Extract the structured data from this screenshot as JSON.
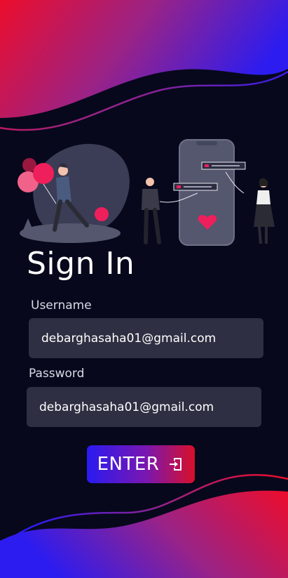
{
  "colors": {
    "background": "#07081c",
    "field_bg": "#2e2f42",
    "accent_red": "#e8102a",
    "accent_blue": "#2a1bf0",
    "heart_pink": "#ef1f5b"
  },
  "signin": {
    "title": "Sign In",
    "username_label": "Username",
    "username_value": "debarghasaha01@gmail.com",
    "password_label": "Password",
    "password_value": "debarghasaha01@gmail.com",
    "enter_label": "ENTER",
    "enter_icon": "login-door-icon"
  }
}
